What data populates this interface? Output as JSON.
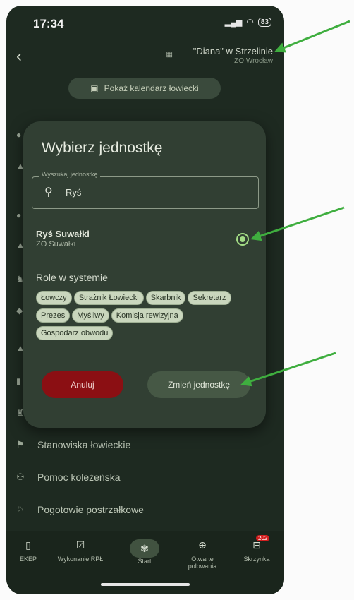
{
  "status": {
    "time": "17:34",
    "battery": "83"
  },
  "header": {
    "title": "\"Diana\" w Strzelinie",
    "subtitle": "ZO Wrocław"
  },
  "calendar_button": {
    "label": "Pokaż kalendarz łowiecki"
  },
  "modal": {
    "title": "Wybierz jednostkę",
    "search": {
      "label": "Wyszukaj jednostkę",
      "value": "Ryś"
    },
    "result": {
      "name": "Ryś Suwałki",
      "sub": "ZO Suwałki",
      "selected": true
    },
    "roles_heading": "Role w systemie",
    "roles": [
      "Łowczy",
      "Strażnik Łowiecki",
      "Skarbnik",
      "Sekretarz",
      "Prezes",
      "Myśliwy",
      "Komisja rewizyjna",
      "Gospodarz obwodu"
    ],
    "cancel_label": "Anuluj",
    "change_label": "Zmień jednostkę"
  },
  "menu": [
    {
      "label": "Stanowiska łowieckie",
      "icon": "flag-icon"
    },
    {
      "label": "Pomoc koleżeńska",
      "icon": "people-icon"
    },
    {
      "label": "Pogotowie postrzałkowe",
      "icon": "dog-icon"
    }
  ],
  "bottom_nav": [
    {
      "label": "EKEP",
      "icon": "book-icon"
    },
    {
      "label": "Wykonanie RPŁ",
      "icon": "calendar-check-icon"
    },
    {
      "label": "Start",
      "icon": "antler-emblem-icon"
    },
    {
      "label": "Otwarte polowania",
      "icon": "crosshair-icon"
    },
    {
      "label": "Skrzynka",
      "icon": "inbox-icon",
      "badge": "202"
    }
  ],
  "colors": {
    "background": "#1e2a21",
    "modal": "#313f33",
    "accent": "#a4dd86",
    "cancel": "#8b0f13",
    "arrow": "#3fae3f"
  }
}
